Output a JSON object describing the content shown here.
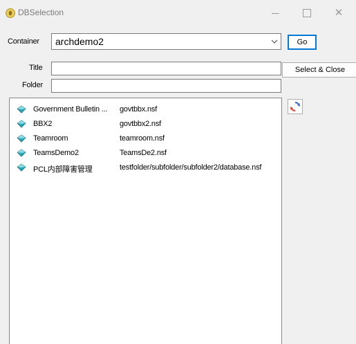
{
  "window": {
    "title": "DBSelection",
    "minimize_icon": "minimize-icon",
    "maximize_icon": "maximize-icon",
    "close_icon": "close-icon",
    "close_glyph": "✕"
  },
  "form": {
    "container_label": "Container",
    "container_value": "archdemo2",
    "title_label": "Title",
    "title_value": "",
    "folder_label": "Folder",
    "folder_value": ""
  },
  "buttons": {
    "go_label": "Go",
    "select_close_label": "Select & Close",
    "refresh_icon": "refresh-icon"
  },
  "list": {
    "row_icon": "database-icon",
    "rows": [
      {
        "name": "Government Bulletin ...",
        "file": "govtbbx.nsf"
      },
      {
        "name": "BBX2",
        "file": "govtbbx2.nsf"
      },
      {
        "name": "Teamroom",
        "file": "teamroom.nsf"
      },
      {
        "name": "TeamsDemo2",
        "file": "TeamsDe2.nsf"
      },
      {
        "name": "PCL内部障害管理",
        "file": "testfolder/subfolder/subfolder2/database.nsf"
      }
    ]
  },
  "colors": {
    "accent": "#0078d7",
    "window_bg": "#f0f0f0",
    "db_icon_teal": "#2aa7b8"
  }
}
